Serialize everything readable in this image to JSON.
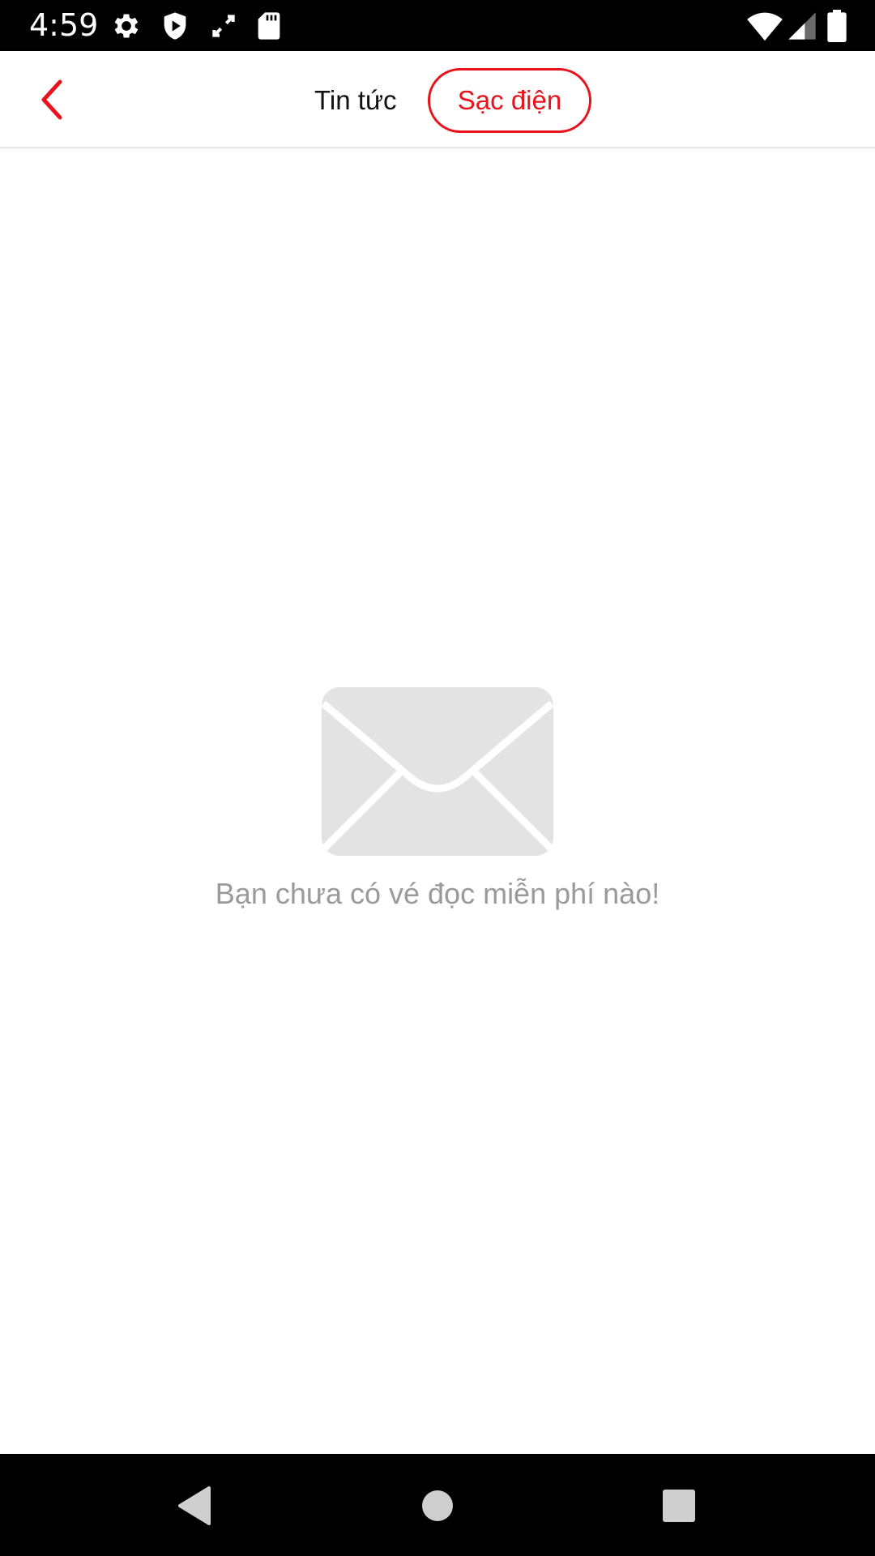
{
  "status_bar": {
    "time": "4:59",
    "icons": [
      "gear-icon",
      "shield-play-icon",
      "screen-rotate-icon",
      "sd-card-icon",
      "wifi-icon",
      "signal-icon",
      "battery-icon"
    ]
  },
  "header": {
    "back_icon": "chevron-left-icon",
    "tabs": [
      {
        "label": "Tin tức",
        "active": false
      },
      {
        "label": "Sạc điện",
        "active": true
      }
    ]
  },
  "empty_state": {
    "icon": "envelope-icon",
    "message": "Bạn chưa có vé đọc miễn phí nào!"
  },
  "nav_bar": {
    "buttons": [
      "back-triangle-icon",
      "home-circle-icon",
      "recents-square-icon"
    ]
  },
  "colors": {
    "accent": "#e8131b",
    "empty_text": "#9a9a9a",
    "icon_gray": "#e3e3e3"
  }
}
